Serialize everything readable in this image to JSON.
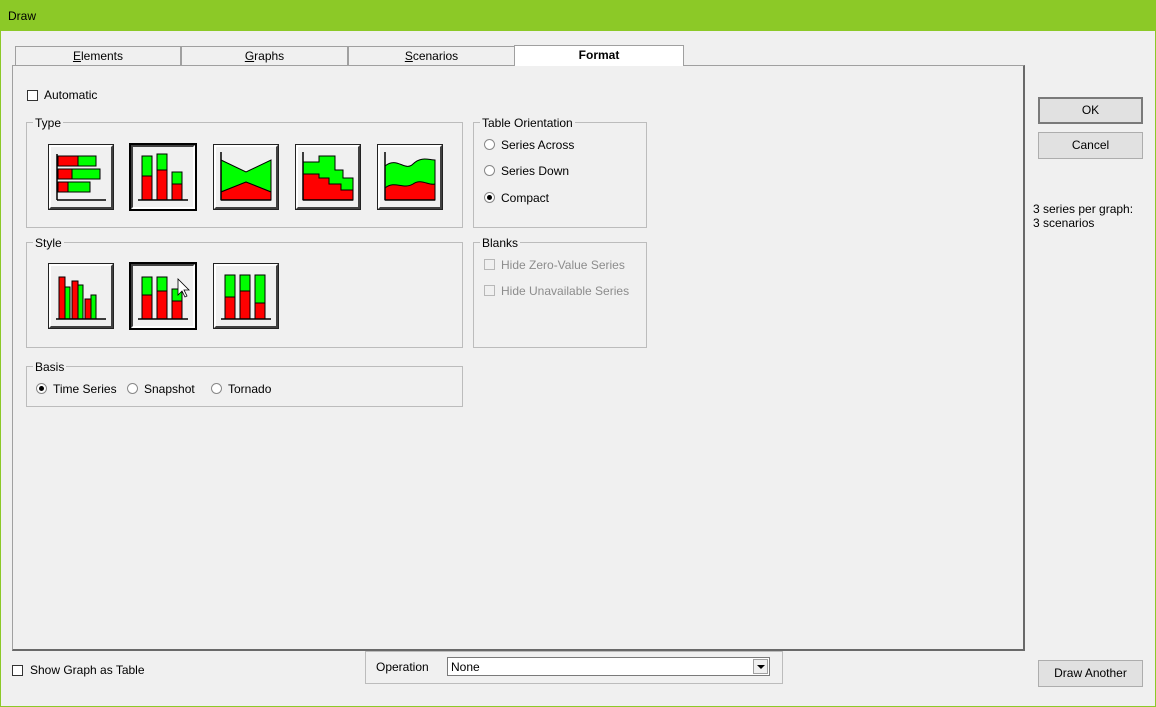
{
  "window": {
    "title": "Draw"
  },
  "tabs": [
    {
      "label": "Elements",
      "underline": "E",
      "rest": "lements"
    },
    {
      "label": "Graphs",
      "underline": "G",
      "rest": "raphs"
    },
    {
      "label": "Scenarios",
      "underline": "S",
      "rest": "cenarios"
    },
    {
      "label": "Format",
      "active": true
    }
  ],
  "format": {
    "automatic_label": "Automatic",
    "type_group": "Type",
    "type_icons": [
      "horizontal-bar-chart-icon",
      "vertical-bar-chart-icon",
      "tornado-area-chart-icon",
      "step-chart-icon",
      "area-chart-icon"
    ],
    "style_group": "Style",
    "style_icons": [
      "clustered-bars-icon",
      "stacked-bars-icon",
      "full-stacked-bars-icon"
    ],
    "basis_group": "Basis",
    "basis_options": [
      "Time Series",
      "Snapshot",
      "Tornado"
    ],
    "basis_selected": "Time Series",
    "orientation_group": "Table Orientation",
    "orientation_options": [
      "Series Across",
      "Series Down",
      "Compact"
    ],
    "orientation_selected": "Compact",
    "blanks_group": "Blanks",
    "blanks_options": [
      "Hide Zero-Value Series",
      "Hide Unavailable Series"
    ]
  },
  "buttons": {
    "ok": "OK",
    "cancel": "Cancel",
    "draw_another": "Draw Another"
  },
  "info": {
    "line1": "3 series per graph:",
    "line2": "3 scenarios"
  },
  "bottom": {
    "show_table_label": "Show Graph as Table",
    "operation_label": "Operation",
    "operation_value": "None"
  },
  "colors": {
    "title_bar": "#8cc927",
    "series_red": "#ff0000",
    "series_green": "#00ff00"
  }
}
